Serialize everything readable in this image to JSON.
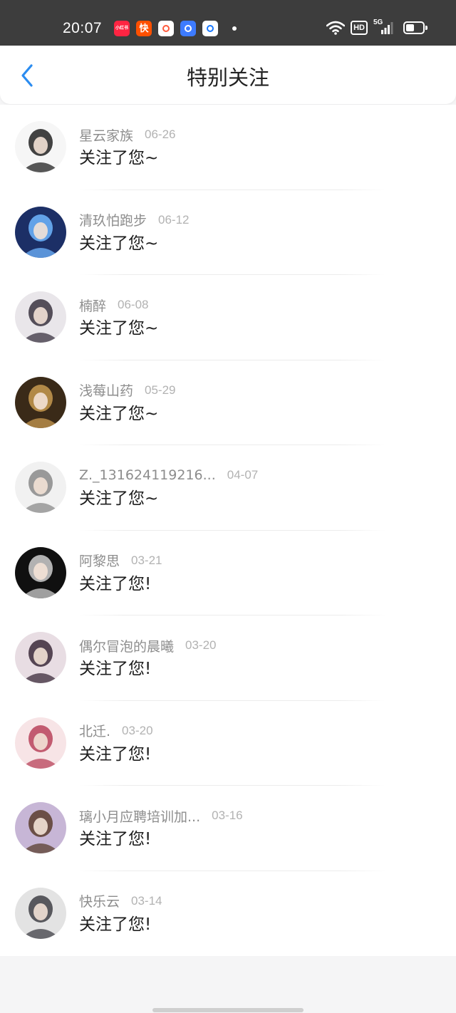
{
  "status_bar": {
    "time": "20:07",
    "notification_icons": [
      {
        "name": "xiaohongshu-app-icon",
        "label": "小红书",
        "bg": "#ff2442",
        "fg": "#ffffff"
      },
      {
        "name": "kuaishou-app-icon",
        "label": "快",
        "bg": "#ff5000",
        "fg": "#ffffff"
      },
      {
        "name": "game-app-icon",
        "label": "",
        "bg": "#ffffff",
        "fg": "#ff5a3c"
      },
      {
        "name": "chat-app-icon",
        "label": "",
        "bg": "#3d7bff",
        "fg": "#ffffff"
      },
      {
        "name": "blue-app-icon",
        "label": "",
        "bg": "#ffffff",
        "fg": "#1677ff"
      }
    ],
    "hd_label": "HD",
    "network_label": "5G"
  },
  "header": {
    "title": "特别关注",
    "back_icon": "chevron-left-icon",
    "accent_color": "#2b8cf0"
  },
  "followers": [
    {
      "username": "星云家族",
      "date": "06-26",
      "message": "关注了您~",
      "avatar_colors": [
        "#f6f6f6",
        "#222222"
      ]
    },
    {
      "username": "清玖怕跑步",
      "date": "06-12",
      "message": "关注了您~",
      "avatar_colors": [
        "#1c2f66",
        "#6fb6ff"
      ]
    },
    {
      "username": "楠醉",
      "date": "06-08",
      "message": "关注了您~",
      "avatar_colors": [
        "#e9e6ea",
        "#3a3340"
      ]
    },
    {
      "username": "浅莓山药",
      "date": "05-29",
      "message": "关注了您~",
      "avatar_colors": [
        "#3a2a18",
        "#c89a50"
      ]
    },
    {
      "username": "Z._131624119216...",
      "date": "04-07",
      "message": "关注了您~",
      "avatar_colors": [
        "#f1f1f1",
        "#8a8a8a"
      ]
    },
    {
      "username": "阿黎思",
      "date": "03-21",
      "message": "关注了您!",
      "avatar_colors": [
        "#101010",
        "#cfcfcf"
      ]
    },
    {
      "username": "偶尔冒泡的晨曦",
      "date": "03-20",
      "message": "关注了您!",
      "avatar_colors": [
        "#e8dde3",
        "#3b2a3a"
      ]
    },
    {
      "username": "北迁.",
      "date": "03-20",
      "message": "关注了您!",
      "avatar_colors": [
        "#f7e4e6",
        "#b8435a"
      ]
    },
    {
      "username": "璃小月应聘培训加...",
      "date": "03-16",
      "message": "关注了您!",
      "avatar_colors": [
        "#c7b6d6",
        "#5a3d2e"
      ]
    },
    {
      "username": "快乐云",
      "date": "03-14",
      "message": "关注了您!",
      "avatar_colors": [
        "#e3e3e3",
        "#3f3f45"
      ]
    }
  ]
}
